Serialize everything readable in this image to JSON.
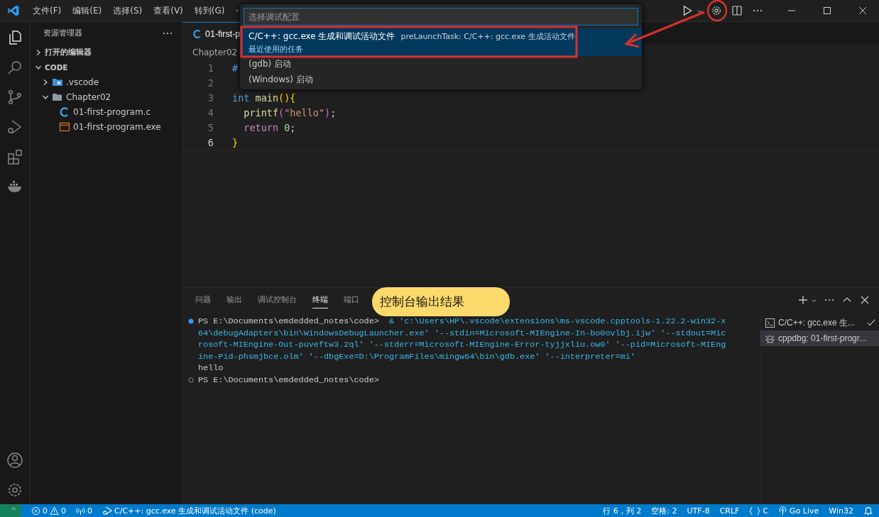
{
  "title_bar": {
    "menus": [
      "文件(F)",
      "编辑(E)",
      "选择(S)",
      "查看(V)",
      "转到(G)"
    ]
  },
  "quick_pick": {
    "placeholder": "选择调试配置",
    "items": [
      {
        "label": "C/C++: gcc.exe 生成和调试活动文件",
        "detail": "preLaunchTask: C/C++: gcc.exe 生成活动文件",
        "group": "最近使用的任务",
        "selected": true
      },
      {
        "label": "(gdb) 启动",
        "selected": false
      },
      {
        "label": "(Windows) 启动",
        "selected": false
      }
    ]
  },
  "sidebar": {
    "title": "资源管理器",
    "sections": [
      {
        "label": "打开的编辑器",
        "expanded": false
      },
      {
        "label": "CODE",
        "expanded": true
      }
    ],
    "tree": [
      {
        "label": ".vscode",
        "kind": "folder",
        "expanded": false
      },
      {
        "label": "Chapter02",
        "kind": "folder",
        "expanded": true,
        "children": [
          {
            "label": "01-first-program.c",
            "kind": "c"
          },
          {
            "label": "01-first-program.exe",
            "kind": "exe"
          }
        ]
      }
    ]
  },
  "editor": {
    "tab": "01-first-p",
    "breadcrumb": "Chapter02",
    "lines": [
      {
        "number": "1",
        "active": false,
        "tokens": [
          {
            "text": "#",
            "kind": "keyword"
          }
        ]
      },
      {
        "number": "2",
        "active": false
      },
      {
        "number": "3",
        "active": false,
        "tokens": [
          {
            "text": "int",
            "kind": "keyword"
          },
          {
            "text": " main",
            "kind": "function"
          },
          {
            "text": "(){",
            "kind": "bracket"
          }
        ]
      },
      {
        "number": "4",
        "active": false,
        "tokens": [
          {
            "text": "  printf",
            "kind": "function"
          },
          {
            "text": "(",
            "kind": "bracket2"
          },
          {
            "text": "\"hello\"",
            "kind": "string"
          },
          {
            "text": ")",
            "kind": "bracket2"
          },
          {
            "text": ";",
            "kind": "plain"
          }
        ]
      },
      {
        "number": "5",
        "active": false,
        "tokens": [
          {
            "text": "  return",
            "kind": "control"
          },
          {
            "text": " 0",
            "kind": "number"
          },
          {
            "text": ";",
            "kind": "plain"
          }
        ]
      },
      {
        "number": "6",
        "active": true,
        "tokens": [
          {
            "text": "}",
            "kind": "bracket"
          }
        ]
      }
    ]
  },
  "panel": {
    "tabs": [
      {
        "label": "问题",
        "selected": false
      },
      {
        "label": "输出",
        "selected": false
      },
      {
        "label": "调试控制台",
        "selected": false
      },
      {
        "label": "终端",
        "selected": true
      },
      {
        "label": "端口",
        "selected": false
      }
    ],
    "terminal": [
      {
        "kind": "command",
        "finished": true,
        "prompt": "PS E:\\Documents\\emdedded_notes\\code>",
        "command": "& 'c:\\Users\\HP\\.vscode\\extensions\\ms-vscode.cpptools-1.22.2-win32-x64\\debugAdapters\\bin\\WindowsDebugLauncher.exe' '--stdin=Microsoft-MIEngine-In-bo0ovlbj.ijw' '--stdout=Microsoft-MIEngine-Out-puveftw3.2ql' '--stderr=Microsoft-MIEngine-Error-tyjjxliu.ow0' '--pid=Microsoft-MIEngine-Pid-phsmjbce.olm' '--dbgExe=D:\\ProgramFiles\\mingw64\\bin\\gdb.exe' '--interpreter=mi'"
      },
      {
        "kind": "output",
        "text": "hello"
      },
      {
        "kind": "command",
        "finished": false,
        "prompt": "PS E:\\Documents\\emdedded_notes\\code>"
      }
    ],
    "terminal_list": [
      {
        "label": "C/C++: gcc.exe 生...",
        "kind": "task",
        "done": true,
        "selected": false
      },
      {
        "label": "cppdbg: 01-first-progr...",
        "kind": "debug",
        "done": false,
        "selected": true
      }
    ]
  },
  "annotation": {
    "callout": "控制台输出结果"
  },
  "status_bar": {
    "errors": "0",
    "warnings": "0",
    "ports": "0",
    "debug": "C/C++: gcc.exe 生成和调试活动文件 (code)",
    "position": "行 6，列 2",
    "indent": "空格: 2",
    "encoding": "UTF-8",
    "eol": "CRLF",
    "language": "C",
    "live": "Go Live",
    "platform": "Win32"
  }
}
